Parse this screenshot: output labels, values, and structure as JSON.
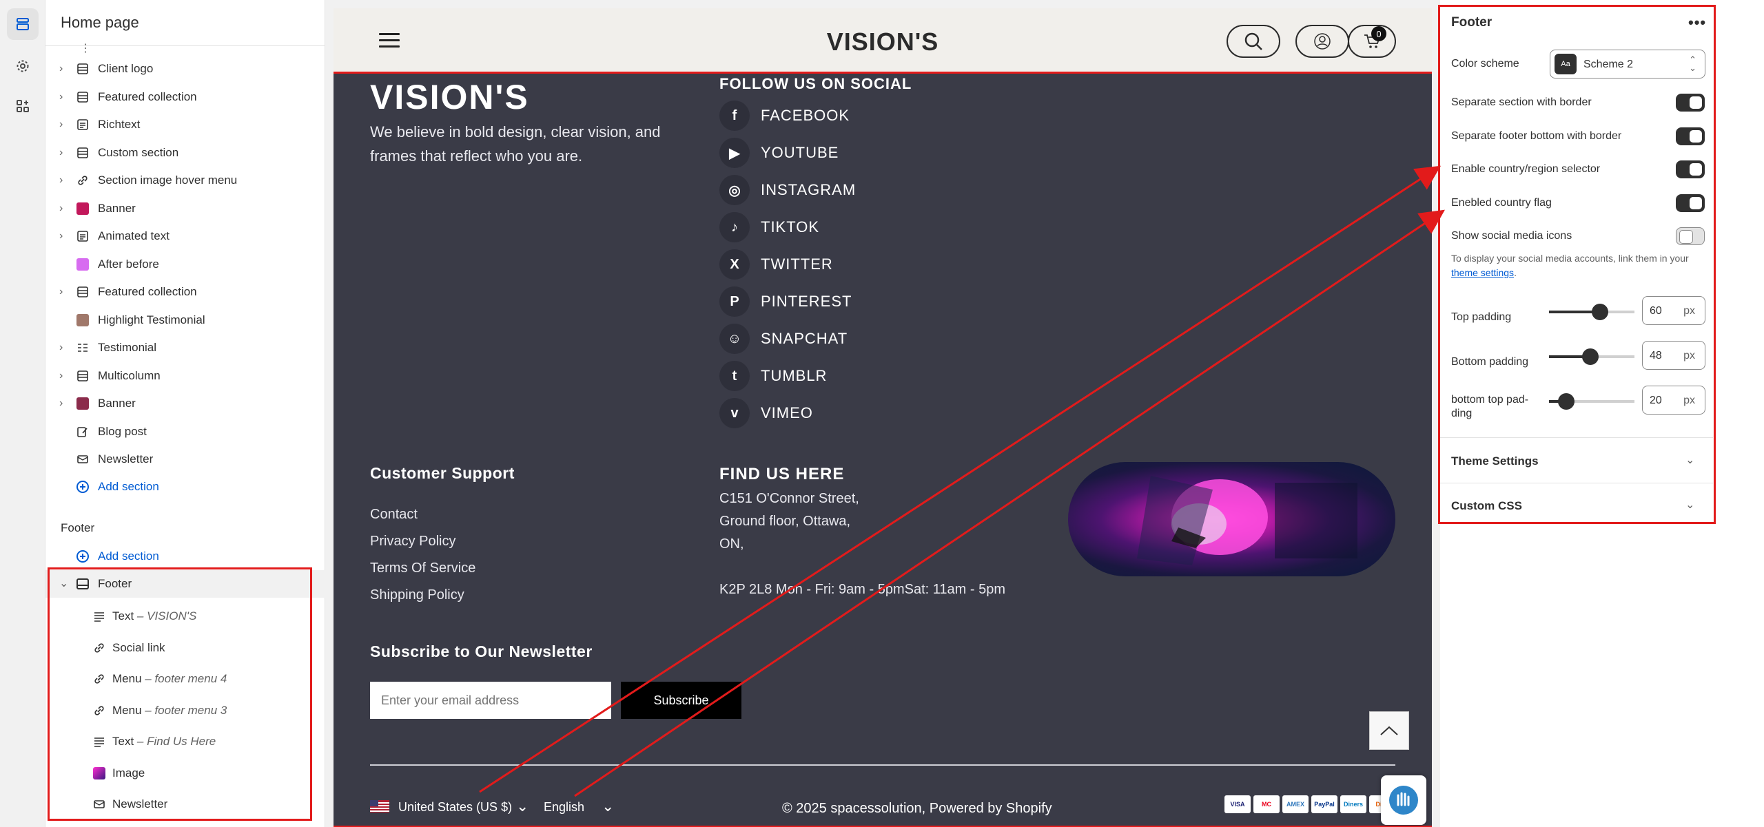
{
  "sidebar": {
    "title": "Home page",
    "items": [
      {
        "label": "Client logo"
      },
      {
        "label": "Featured collection"
      },
      {
        "label": "Richtext"
      },
      {
        "label": "Custom section"
      },
      {
        "label": "Section image hover menu"
      },
      {
        "label": "Banner"
      },
      {
        "label": "Animated text"
      },
      {
        "label": "After before"
      },
      {
        "label": "Featured collection"
      },
      {
        "label": "Highlight Testimonial"
      },
      {
        "label": "Testimonial"
      },
      {
        "label": "Multicolumn"
      },
      {
        "label": "Banner"
      },
      {
        "label": "Blog post"
      },
      {
        "label": "Newsletter"
      }
    ],
    "add_section": "Add section",
    "footer_group": "Footer",
    "footer_add_section": "Add section",
    "footer_section": "Footer",
    "footer_blocks": [
      {
        "label": "Text",
        "sub": "– VISION'S"
      },
      {
        "label": "Social link",
        "sub": ""
      },
      {
        "label": "Menu",
        "sub": "– footer menu 4"
      },
      {
        "label": "Menu",
        "sub": "– footer menu 3"
      },
      {
        "label": "Text",
        "sub": "– Find Us Here"
      },
      {
        "label": "Image",
        "sub": ""
      },
      {
        "label": "Newsletter",
        "sub": ""
      }
    ]
  },
  "store": {
    "logo": "VISION'S",
    "cart_count": "0",
    "footer": {
      "brand": "VISION'S",
      "description": "We believe in bold design, clear vision, and frames that reflect who you are.",
      "social_heading": "FOLLOW US ON SOCIAL",
      "social": [
        {
          "name": "FACEBOOK",
          "glyph": "f"
        },
        {
          "name": "YOUTUBE",
          "glyph": "▶"
        },
        {
          "name": "INSTAGRAM",
          "glyph": "◎"
        },
        {
          "name": "TIKTOK",
          "glyph": "♪"
        },
        {
          "name": "TWITTER",
          "glyph": "X"
        },
        {
          "name": "PINTEREST",
          "glyph": "P"
        },
        {
          "name": "SNAPCHAT",
          "glyph": "☺"
        },
        {
          "name": "TUMBLR",
          "glyph": "t"
        },
        {
          "name": "VIMEO",
          "glyph": "v"
        }
      ],
      "support_heading": "Customer Support",
      "support_links": [
        "Contact",
        "Privacy Policy",
        "Terms Of Service",
        "Shipping Policy"
      ],
      "find_heading": "FIND US HERE",
      "address": "C151 O'Connor Street,\nGround floor, Ottawa,\nON,\n\nK2P 2L8 Mon - Fri: 9am - 5pmSat: 11am - 5pm",
      "newsletter_heading": "Subscribe to Our Newsletter",
      "email_placeholder": "Enter your email address",
      "subscribe_label": "Subscribe",
      "country": "United States (US $)",
      "language": "English",
      "copyright": "© 2025 spacessolution, Powered by Shopify",
      "payments": [
        "VISA",
        "MC",
        "AMEX",
        "PayPal",
        "Diners",
        "Disc"
      ]
    }
  },
  "settings": {
    "title": "Footer",
    "color_scheme_label": "Color scheme",
    "color_scheme_value": "Scheme 2",
    "scheme_chip": "Aa",
    "toggles": [
      {
        "label": "Separate section with border",
        "on": true
      },
      {
        "label": "Separate footer bottom with border",
        "on": true
      },
      {
        "label": "Enable country/region selector",
        "on": true
      },
      {
        "label": "Enebled country flag",
        "on": true
      },
      {
        "label": "Show social media icons",
        "on": false
      }
    ],
    "social_help_prefix": "To display your social media accounts, link them in your ",
    "social_help_link": "theme settings",
    "social_help_suffix": ".",
    "paddings": [
      {
        "label": "Top padding",
        "value": "60",
        "unit": "px",
        "fraction": 0.6
      },
      {
        "label": "Bottom padding",
        "value": "48",
        "unit": "px",
        "fraction": 0.48
      },
      {
        "label": "bottom top pad-\nding",
        "value": "20",
        "unit": "px",
        "fraction": 0.2
      }
    ],
    "sections": [
      "Theme Settings",
      "Custom CSS"
    ]
  },
  "colors": {
    "footer_bg": "#3a3b47",
    "accent_link": "#005bd3",
    "highlight": "#e21b1b"
  }
}
